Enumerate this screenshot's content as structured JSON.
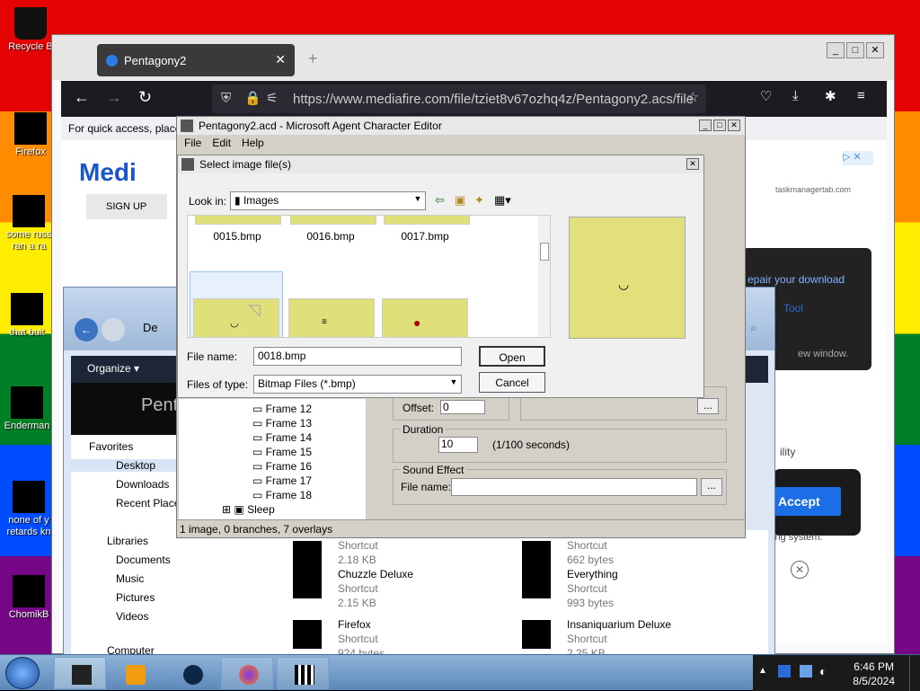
{
  "desktop": {
    "icons": [
      {
        "label": "Recycle Bin",
        "display": "Recycle B"
      },
      {
        "label": "Firefox"
      },
      {
        "label": "some russ... ran a ra...",
        "l1": "some russ",
        "l2": "ran a ra"
      },
      {
        "label": "that buitts",
        "display": "that buit"
      },
      {
        "label": "Enderman"
      },
      {
        "label": "none of y retards kn",
        "l1": "none of y",
        "l2": "retards kn"
      },
      {
        "label": "ChomikB"
      }
    ]
  },
  "firefox": {
    "tab_title": "Pentagony2",
    "url": "https://www.mediafire.com/file/tziet8v67ozhq4z/Pentagony2.acs/file",
    "bookmarks_text": "For quick access, place",
    "mediafire": {
      "logo": "Medi",
      "signup": "SIGN UP",
      "ad": "taskmanagertab.com",
      "repair": "epair your download",
      "tool": "Tool",
      "newwindow": "ew window.",
      "accept": "Accept",
      "ility": "ility",
      "system": "ing system."
    }
  },
  "explorer": {
    "title": "De",
    "organize": "Organize",
    "folder_title": "Pent",
    "nav": [
      "Favorites",
      "Desktop",
      "Downloads",
      "Recent Place",
      "Libraries",
      "Documents",
      "Music",
      "Pictures",
      "Videos",
      "Computer"
    ],
    "files": [
      {
        "name": "",
        "type": "Shortcut",
        "size": "2.18 KB"
      },
      {
        "name": "",
        "type": "Shortcut",
        "size": "662 bytes"
      },
      {
        "name": "Chuzzle Deluxe",
        "type": "Shortcut",
        "size": "2.15 KB"
      },
      {
        "name": "Everything",
        "type": "Shortcut",
        "size": "993 bytes"
      },
      {
        "name": "Firefox",
        "type": "Shortcut",
        "size": "924 bytes"
      },
      {
        "name": "Insaniquarium Deluxe",
        "type": "Shortcut",
        "size": "2.25 KB"
      }
    ]
  },
  "ace": {
    "title": "Pentagony2.acd - Microsoft Agent Character Editor",
    "menu": [
      "File",
      "Edit",
      "Help"
    ],
    "tree": [
      "Frame 12",
      "Frame 13",
      "Frame 14",
      "Frame 15",
      "Frame 16",
      "Frame 17",
      "Frame 18",
      "Sleep"
    ],
    "offset_label": "Offset:",
    "offset_value": "0",
    "duration_label": "Duration",
    "duration_value": "10",
    "duration_unit": "(1/100 seconds)",
    "sound_label": "Sound Effect",
    "filename_label": "File name:",
    "browse": "...",
    "status": "1 image, 0 branches, 7 overlays"
  },
  "dialog": {
    "title": "Select image file(s)",
    "lookin_label": "Look in:",
    "lookin_value": "Images",
    "files": [
      "0015.bmp",
      "0016.bmp",
      "0017.bmp"
    ],
    "filename_label": "File name:",
    "filename_value": "0018.bmp",
    "filetype_label": "Files of type:",
    "filetype_value": "Bitmap Files (*.bmp)",
    "open": "Open",
    "cancel": "Cancel"
  },
  "taskbar": {
    "time": "6:46 PM",
    "date": "8/5/2024"
  },
  "colors": {
    "accent": "#2667d6",
    "bmp_face": "#e0e07a"
  }
}
